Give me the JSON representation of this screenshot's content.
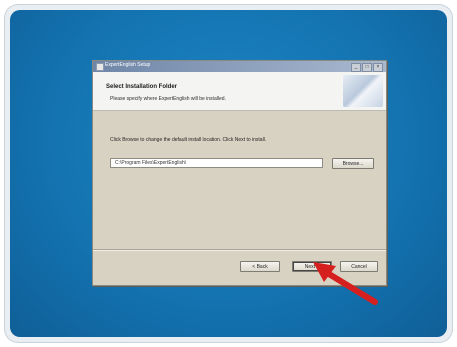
{
  "window": {
    "title": "ExpertEnglish Setup",
    "minimize": "_",
    "maximize": "□",
    "close": "×"
  },
  "header": {
    "title": "Select Installation Folder",
    "subtitle": "Please specify where ExpertEnglish will be installed."
  },
  "body": {
    "instruction": "Click Browse to change the default install location. Click Next to install.",
    "install_path": "C:\\Program Files\\ExpertEnglish\\",
    "browse_label": "Browse..."
  },
  "footer": {
    "back_label": "< Back",
    "next_label": "Next >",
    "cancel_label": "Cancel"
  },
  "colors": {
    "desktop": "#1474b2",
    "dialog": "#d8d2c2",
    "arrow": "#d61f1f"
  }
}
